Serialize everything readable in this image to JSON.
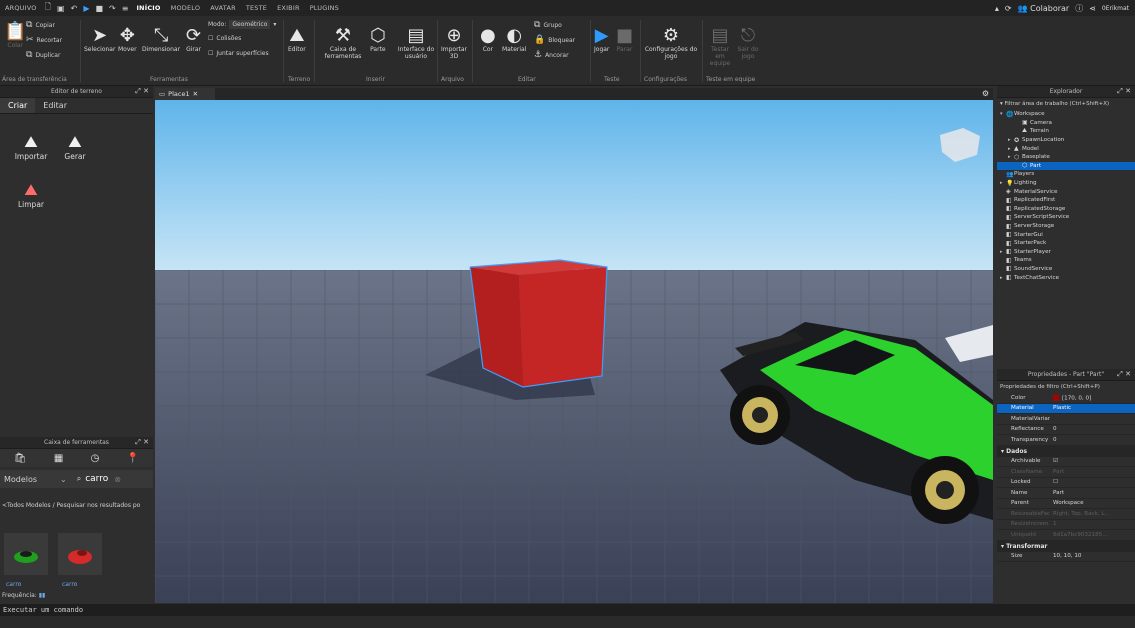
{
  "menu": {
    "file": "ARQUIVO",
    "tabs": [
      "INÍCIO",
      "MODELO",
      "AVATAR",
      "TESTE",
      "EXIBIR",
      "PLUGINS"
    ],
    "right": {
      "collaborate": "Colaborar",
      "user": "0Erikmat"
    }
  },
  "ribbon": {
    "copy": "Copiar",
    "cut": "Recortar",
    "paste": "Colar",
    "duplicate": "Duplicar",
    "select": "Selecionar",
    "move": "Mover",
    "scale": "Dimensionar",
    "rotate": "Girar",
    "mode_label": "Modo:",
    "mode_value": "Geométrico",
    "collisions": "Colisões",
    "join_surfaces": "Juntar superfícies",
    "editor": "Editor",
    "toolbox": "Caixa de ferramentas",
    "part": "Parte",
    "ui": "Interface do usuário",
    "import3d": "Importar 3D",
    "color": "Cor",
    "material": "Material",
    "group": "Grupo",
    "lock": "Bloquear",
    "anchor": "Ancorar",
    "play": "Jogar",
    "pause": "Parar",
    "game_settings": "Configurações do jogo",
    "team_test": "Testar em equipe",
    "exit_game": "Sair do jogo",
    "groups": {
      "clipboard": "Área de transferência",
      "tools": "Ferramentas",
      "terrain": "Terreno",
      "insert": "Inserir",
      "file": "Arquivo",
      "edit": "Editar",
      "test": "Teste",
      "settings": "Configurações",
      "team_test": "Teste em equipe"
    }
  },
  "terrain_editor": {
    "title": "Editor de terreno",
    "tabs": [
      "Criar",
      "Editar"
    ],
    "tools": [
      "Importar",
      "Gerar",
      "Limpar"
    ]
  },
  "toolbox": {
    "title": "Caixa de ferramentas",
    "category": "Modelos",
    "search_value": "carro",
    "note": "<Todos Modelos / Pesquisar nos resultados po",
    "items": [
      "carro",
      "carro"
    ],
    "footer": "Frequência:"
  },
  "viewport": {
    "tab": "Place1"
  },
  "explorer": {
    "title": "Explorador",
    "filter_placeholder": "Filtrar área de trabalho (Ctrl+Shift+X)",
    "tree": [
      {
        "label": "Workspace",
        "indent": 0,
        "arrow": "▾",
        "icon": "🌐",
        "selected": false
      },
      {
        "label": "Camera",
        "indent": 2,
        "arrow": "",
        "icon": "▣",
        "selected": false
      },
      {
        "label": "Terrain",
        "indent": 2,
        "arrow": "",
        "icon": "⛰",
        "selected": false
      },
      {
        "label": "SpawnLocation",
        "indent": 1,
        "arrow": "▸",
        "icon": "✪",
        "selected": false
      },
      {
        "label": "Model",
        "indent": 1,
        "arrow": "▸",
        "icon": "▲",
        "selected": false
      },
      {
        "label": "Baseplate",
        "indent": 1,
        "arrow": "▸",
        "icon": "⬡",
        "selected": false
      },
      {
        "label": "Part",
        "indent": 2,
        "arrow": "",
        "icon": "⬡",
        "selected": true
      },
      {
        "label": "Players",
        "indent": 0,
        "arrow": "",
        "icon": "👥",
        "selected": false
      },
      {
        "label": "Lighting",
        "indent": 0,
        "arrow": "▸",
        "icon": "💡",
        "selected": false
      },
      {
        "label": "MaterialService",
        "indent": 0,
        "arrow": "",
        "icon": "◈",
        "selected": false
      },
      {
        "label": "ReplicatedFirst",
        "indent": 0,
        "arrow": "",
        "icon": "◧",
        "selected": false
      },
      {
        "label": "ReplicatedStorage",
        "indent": 0,
        "arrow": "",
        "icon": "◧",
        "selected": false
      },
      {
        "label": "ServerScriptService",
        "indent": 0,
        "arrow": "",
        "icon": "◧",
        "selected": false
      },
      {
        "label": "ServerStorage",
        "indent": 0,
        "arrow": "",
        "icon": "◧",
        "selected": false
      },
      {
        "label": "StarterGui",
        "indent": 0,
        "arrow": "",
        "icon": "◧",
        "selected": false
      },
      {
        "label": "StarterPack",
        "indent": 0,
        "arrow": "",
        "icon": "◧",
        "selected": false
      },
      {
        "label": "StarterPlayer",
        "indent": 0,
        "arrow": "▸",
        "icon": "◧",
        "selected": false
      },
      {
        "label": "Teams",
        "indent": 0,
        "arrow": "",
        "icon": "◧",
        "selected": false
      },
      {
        "label": "SoundService",
        "indent": 0,
        "arrow": "",
        "icon": "◧",
        "selected": false
      },
      {
        "label": "TextChatService",
        "indent": 0,
        "arrow": "▸",
        "icon": "◧",
        "selected": false
      }
    ]
  },
  "properties": {
    "title": "Propriedades - Part \"Part\"",
    "filter_placeholder": "Propriedades de filtro (Ctrl+Shift+P)",
    "rows1": [
      {
        "k": "Color",
        "v": "[170, 0, 0]",
        "hl": false,
        "dim": false,
        "swatch": "#aa0000"
      },
      {
        "k": "Material",
        "v": "Plastic",
        "hl": true,
        "dim": false,
        "swatch": ""
      },
      {
        "k": "MaterialVariant",
        "v": "",
        "hl": false,
        "dim": false,
        "swatch": ""
      },
      {
        "k": "Reflectance",
        "v": "0",
        "hl": false,
        "dim": false,
        "swatch": ""
      },
      {
        "k": "Transparency",
        "v": "0",
        "hl": false,
        "dim": false,
        "swatch": ""
      }
    ],
    "section_data": "Dados",
    "rows2": [
      {
        "k": "Archivable",
        "v": "☑",
        "hl": false,
        "dim": false,
        "swatch": ""
      },
      {
        "k": "ClassName",
        "v": "Part",
        "hl": false,
        "dim": true,
        "swatch": ""
      },
      {
        "k": "Locked",
        "v": "☐",
        "hl": false,
        "dim": false,
        "swatch": ""
      },
      {
        "k": "Name",
        "v": "Part",
        "hl": false,
        "dim": false,
        "swatch": ""
      },
      {
        "k": "Parent",
        "v": "Workspace",
        "hl": false,
        "dim": false,
        "swatch": ""
      },
      {
        "k": "ResizeableFaces",
        "v": "Right, Top, Back, L...",
        "hl": false,
        "dim": true,
        "swatch": ""
      },
      {
        "k": "ResizeIncrem...",
        "v": "1",
        "hl": false,
        "dim": true,
        "swatch": ""
      },
      {
        "k": "UniqueId",
        "v": "6d1a7bc9032185...",
        "hl": false,
        "dim": true,
        "swatch": ""
      }
    ],
    "section_transform": "Transformar",
    "size_label": "Size",
    "size_value": "10, 10, 10"
  },
  "command_bar": {
    "placeholder": "Executar um comando"
  }
}
